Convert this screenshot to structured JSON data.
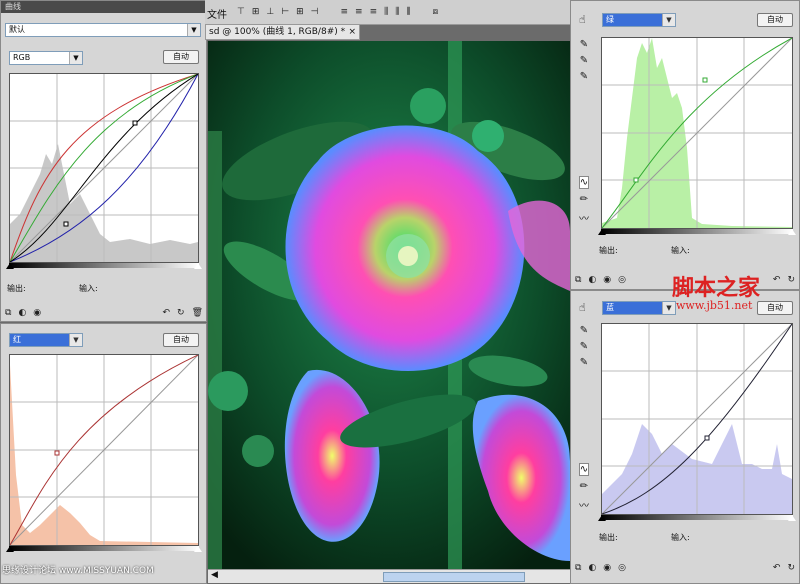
{
  "panel_top_left": {
    "title": "曲线",
    "preset": "默认",
    "channel": "RGB",
    "auto_label": "自动",
    "output_label": "输出:",
    "input_label": "输入:"
  },
  "panel_bottom_left": {
    "channel": "红",
    "auto_label": "自动"
  },
  "menubar": {
    "file_label": "文件"
  },
  "document": {
    "tab_title": "sd @ 100% (曲线 1, RGB/8#) *",
    "close_symbol": "×"
  },
  "panel_top_right": {
    "channel": "绿",
    "auto_label": "自动",
    "output_label": "输出:",
    "input_label": "输入:"
  },
  "panel_bottom_right": {
    "channel": "蓝",
    "auto_label": "自动",
    "output_label": "输出:",
    "input_label": "输入:"
  },
  "watermarks": {
    "jb51_title": "脚本之家",
    "jb51_url": "www.jb51.net",
    "missyuan": "思缘设计论坛 www.MISSYUAN.COM"
  },
  "colors": {
    "red_curve": "#c33",
    "green_curve": "#3a3",
    "blue_curve": "#22a",
    "green_hist": "#b9f0a6",
    "blue_hist": "#c9c9f0",
    "red_hist": "#f5c2a8",
    "gray_hist": "#c8c8c8"
  }
}
